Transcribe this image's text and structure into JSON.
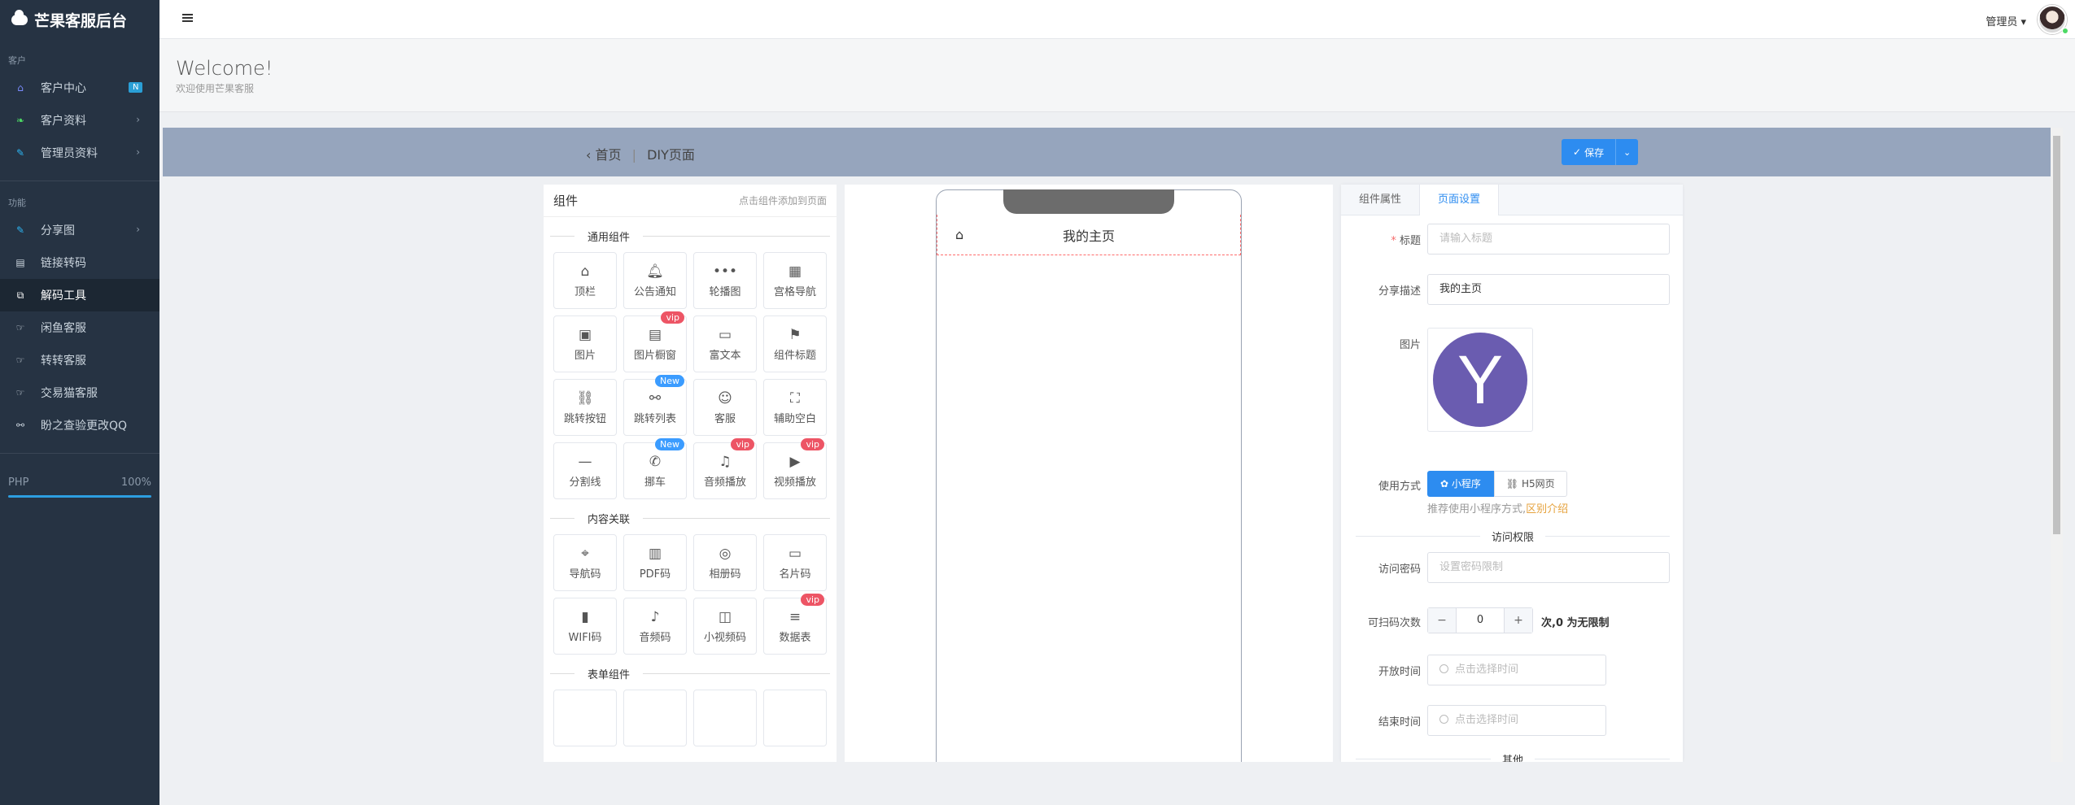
{
  "sidebar": {
    "brand": "芒果客服后台",
    "section_customer": "客户",
    "section_function": "功能",
    "items": [
      {
        "label": "客户中心",
        "badge": "N"
      },
      {
        "label": "客户资料"
      },
      {
        "label": "管理员资料"
      },
      {
        "label": "分享图"
      },
      {
        "label": "链接转码"
      },
      {
        "label": "解码工具"
      },
      {
        "label": "闲鱼客服"
      },
      {
        "label": "转转客服"
      },
      {
        "label": "交易猫客服"
      },
      {
        "label": "盼之查验更改QQ"
      }
    ],
    "php_label": "PHP",
    "php_percent": "100%"
  },
  "topbar": {
    "admin_label": "管理员"
  },
  "welcome": {
    "title": "Welcome!",
    "subtitle": "欢迎使用芒果客服"
  },
  "diy": {
    "crumb_home": "首页",
    "crumb_current": "DIY页面",
    "save_label": "保存"
  },
  "components": {
    "title": "组件",
    "hint": "点击组件添加到页面",
    "group_common": "通用组件",
    "common": [
      {
        "label": "顶栏",
        "icon": "home-icon"
      },
      {
        "label": "公告通知",
        "icon": "bell-icon"
      },
      {
        "label": "轮播图",
        "icon": "dots-icon"
      },
      {
        "label": "宫格导航",
        "icon": "grid-icon"
      },
      {
        "label": "图片",
        "icon": "image-icon"
      },
      {
        "label": "图片橱窗",
        "icon": "image-window-icon",
        "tag": "vip"
      },
      {
        "label": "富文本",
        "icon": "rich-text-icon"
      },
      {
        "label": "组件标题",
        "icon": "flag-icon"
      },
      {
        "label": "跳转按钮",
        "icon": "link-icon"
      },
      {
        "label": "跳转列表",
        "icon": "share-icon",
        "tag": "New"
      },
      {
        "label": "客服",
        "icon": "user-icon"
      },
      {
        "label": "辅助空白",
        "icon": "blank-icon"
      },
      {
        "label": "分割线",
        "icon": "divider-icon"
      },
      {
        "label": "挪车",
        "icon": "phone-icon",
        "tag": "New"
      },
      {
        "label": "音频播放",
        "icon": "audio-icon",
        "tag": "vip"
      },
      {
        "label": "视频播放",
        "icon": "video-icon",
        "tag": "vip"
      }
    ],
    "group_content": "内容关联",
    "content": [
      {
        "label": "导航码",
        "icon": "location-icon"
      },
      {
        "label": "PDF码",
        "icon": "pdf-icon"
      },
      {
        "label": "相册码",
        "icon": "album-icon"
      },
      {
        "label": "名片码",
        "icon": "card-icon"
      },
      {
        "label": "WIFI码",
        "icon": "bar-chart-icon"
      },
      {
        "label": "音频码",
        "icon": "mic-icon"
      },
      {
        "label": "小视频码",
        "icon": "camera-icon"
      },
      {
        "label": "数据表",
        "icon": "database-icon",
        "tag": "vip"
      }
    ],
    "group_form": "表单组件"
  },
  "preview": {
    "page_title": "我的主页"
  },
  "props": {
    "tab_component": "组件属性",
    "tab_page": "页面设置",
    "title_label": "标题",
    "title_placeholder": "请输入标题",
    "share_label": "分享描述",
    "share_value": "我的主页",
    "image_label": "图片",
    "logo_letter": "Y",
    "usage_label": "使用方式",
    "usage_mini": "小程序",
    "usage_h5": "H5网页",
    "usage_hint": "推荐使用小程序方式,",
    "usage_link": "区别介绍",
    "access_title": "访问权限",
    "password_label": "访问密码",
    "password_placeholder": "设置密码限制",
    "scan_label": "可扫码次数",
    "scan_minus": "−",
    "scan_value": "0",
    "scan_plus": "+",
    "scan_unit": "次,0 为无限制",
    "open_label": "开放时间",
    "open_placeholder": "点击选择时间",
    "end_label": "结束时间",
    "end_placeholder": "点击选择时间",
    "other_title": "其他"
  },
  "colors": {
    "sidebar_bg": "#263343",
    "accent": "#2d8cf0",
    "vip_tag": "#ed5565",
    "new_tag": "#3b9cff",
    "logo_bg": "#6a5cb0"
  }
}
